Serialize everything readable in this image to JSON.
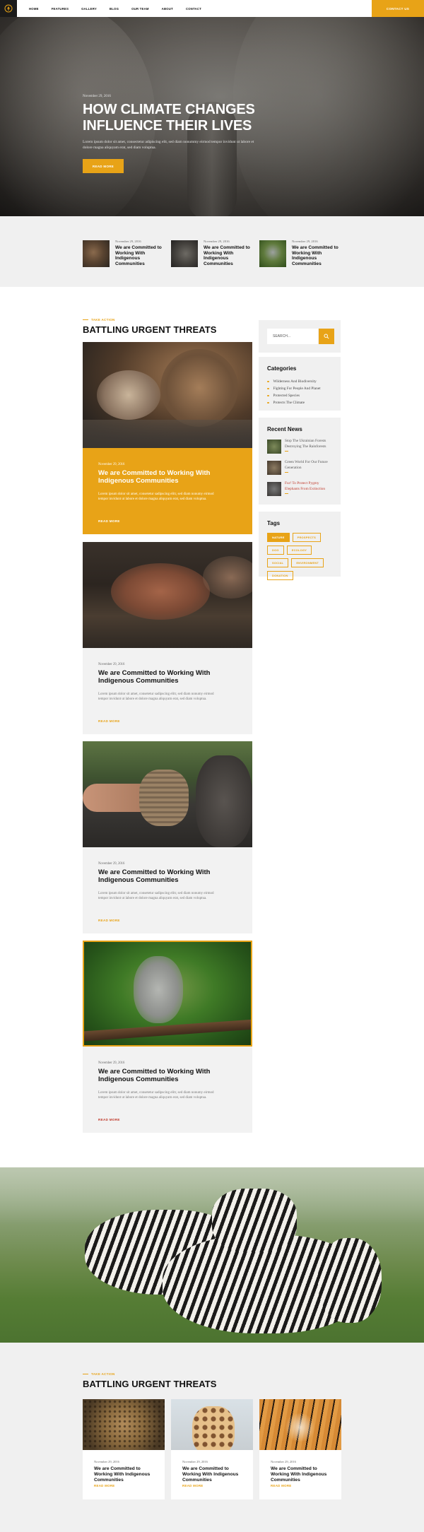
{
  "nav": {
    "items": [
      "HOME",
      "FEATURES",
      "GALLERY",
      "BLOG",
      "OUR TEAM",
      "ABOUT",
      "CONTACT"
    ],
    "contact_button": "CONTACT US",
    "logo_icon": "tree-icon"
  },
  "hero": {
    "date": "November 29, 2016",
    "title": "HOW CLIMATE CHANGES INFLUENCE THEIR LIVES",
    "text": "Lorem ipsum dolor sit amet, consectetur adipiscing elit, sed diam nonummy eirmod tempor invidunt ut labore et dolore magna aliquyam erat, sed diam voluptua.",
    "button": "READ MORE"
  },
  "featured": [
    {
      "date": "November 29, 2016",
      "title": "We are Committed to Working With Indigenous Communities"
    },
    {
      "date": "November 29, 2016",
      "title": "We are Committed to Working With Indigenous Communities"
    },
    {
      "date": "November 29, 2016",
      "title": "We are Committed to Working With Indigenous Communities"
    }
  ],
  "main": {
    "eyebrow": "TAKE ACTION",
    "title": "BATTLING URGENT THREATS",
    "posts": [
      {
        "date": "November 29, 2016",
        "title": "We are Committed to Working With Indigenous Communities",
        "text": "Lorem ipsum dolor sit amet, consetetur sadipscing elitr, sed diam nonumy eirmod tempor invidunt ut labore et dolore magna aliquyam erat, sed diam voluptua.",
        "more": "READ MORE"
      },
      {
        "date": "November 29, 2016",
        "title": "We are Committed to Working With Indigenous Communities",
        "text": "Lorem ipsum dolor sit amet, consetetur sadipscing elitr, sed diam nonumy eirmod tempor invidunt ut labore et dolore magna aliquyam erat, sed diam voluptua.",
        "more": "READ MORE"
      },
      {
        "date": "November 29, 2016",
        "title": "We are Committed to Working With Indigenous Communities",
        "text": "Lorem ipsum dolor sit amet, consetetur sadipscing elitr, sed diam nonumy eirmod tempor invidunt ut labore et dolore magna aliquyam erat, sed diam voluptua.",
        "more": "READ MORE"
      },
      {
        "date": "November 29, 2016",
        "title": "We are Committed to Working With Indigenous Communities",
        "text": "Lorem ipsum dolor sit amet, consetetur sadipscing elitr, sed diam nonumy eirmod tempor invidunt ut labore et dolore magna aliquyam erat, sed diam voluptua.",
        "more": "READ MORE"
      }
    ]
  },
  "sidebar": {
    "search_placeholder": "SEARCH...",
    "categories_title": "Categories",
    "categories": [
      "Wilderness And Biodiversity",
      "Fighting For People And Planet",
      "Protected Species",
      "Protects The Climate"
    ],
    "news_title": "Recent News",
    "news": [
      "Stop The Ukrainian Forests Destroying The Rainforests",
      "Green World For Our Future Generation",
      "Fur! To Protect Pygmy Elephants From Extinction"
    ],
    "tags_title": "Tags",
    "tags": [
      "NATURE",
      "PROSPECTS",
      "DOG",
      "ECOLOGY",
      "SOCIAL",
      "ENVIRONMENT",
      "DONATION"
    ]
  },
  "bottom": {
    "eyebrow": "TAKE ACTION",
    "title": "BATTLING URGENT THREATS",
    "cards": [
      {
        "date": "November 29, 2016",
        "title": "We are Committed to Working With Indigenous Communities",
        "more": "READ MORE"
      },
      {
        "date": "November 29, 2016",
        "title": "We are Committed to Working With Indigenous Communities",
        "more": "READ MORE"
      },
      {
        "date": "November 29, 2016",
        "title": "We are Committed to Working With Indigenous Communities",
        "more": "READ MORE"
      }
    ]
  },
  "colors": {
    "accent": "#e8a317",
    "dark": "#1b1b1b",
    "light_bg": "#f0f0f0",
    "link_red": "#c0392b"
  }
}
